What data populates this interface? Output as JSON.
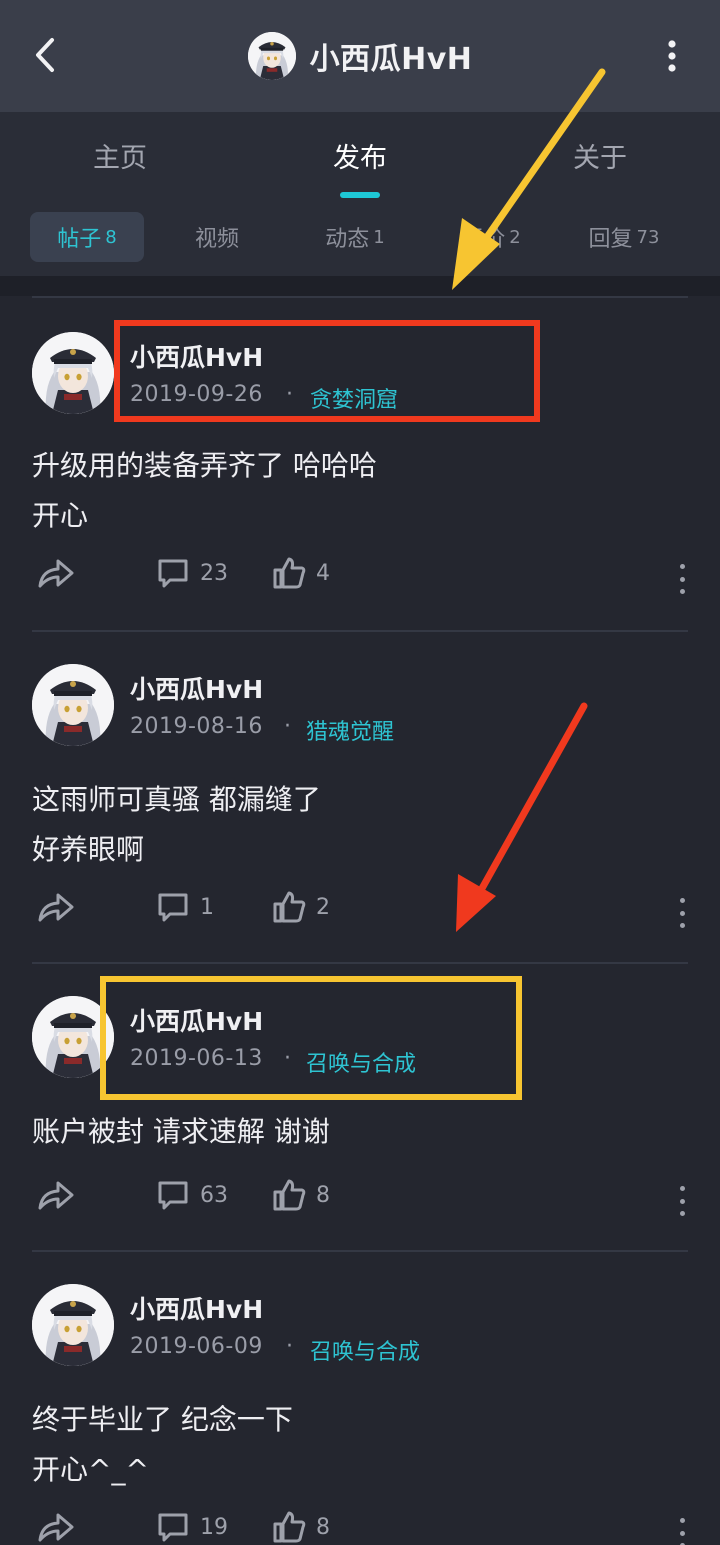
{
  "header": {
    "title": "小西瓜HvH",
    "icons": {
      "back": "back-arrow-icon",
      "more": "more-vertical-icon"
    }
  },
  "main_tabs": [
    {
      "label": "主页",
      "active": false
    },
    {
      "label": "发布",
      "active": true
    },
    {
      "label": "关于",
      "active": false
    }
  ],
  "sub_tabs": [
    {
      "label": "帖子",
      "count": "8",
      "active": true
    },
    {
      "label": "视频",
      "count": "",
      "active": false
    },
    {
      "label": "动态",
      "count": "1",
      "active": false
    },
    {
      "label": "评价",
      "count": "2",
      "active": false
    },
    {
      "label": "回复",
      "count": "73",
      "active": false
    }
  ],
  "posts": [
    {
      "author": "小西瓜HvH",
      "date": "2019-09-26",
      "separator": "·",
      "forum": "贪婪洞窟",
      "content": [
        "升级用的装备弄齐了 哈哈哈",
        "开心"
      ],
      "comments": "23",
      "likes": "4"
    },
    {
      "author": "小西瓜HvH",
      "date": "2019-08-16",
      "separator": "·",
      "forum": "猎魂觉醒",
      "content": [
        "这雨师可真骚 都漏缝了",
        "好养眼啊"
      ],
      "comments": "1",
      "likes": "2"
    },
    {
      "author": "小西瓜HvH",
      "date": "2019-06-13",
      "separator": "·",
      "forum": "召唤与合成",
      "content": [
        "账户被封 请求速解 谢谢"
      ],
      "comments": "63",
      "likes": "8"
    },
    {
      "author": "小西瓜HvH",
      "date": "2019-06-09",
      "separator": "·",
      "forum": "召唤与合成",
      "content": [
        "终于毕业了 纪念一下",
        "开心^_^"
      ],
      "comments": "19",
      "likes": "8"
    }
  ],
  "colors": {
    "accent": "#2ec4d2",
    "background": "#24262f",
    "annotation_red": "#f0391e",
    "annotation_yellow": "#f7c531"
  }
}
